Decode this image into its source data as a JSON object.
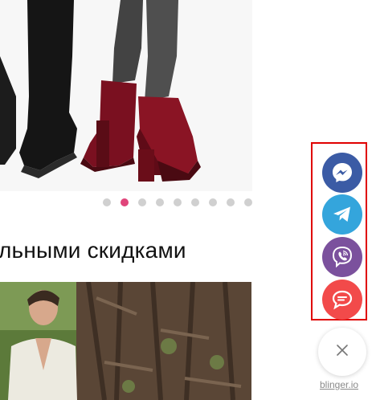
{
  "carousel": {
    "dot_count": 9,
    "active_index": 1,
    "active_color": "#e0457b",
    "dot_color": "#d0d0d0"
  },
  "section": {
    "heading": "льными скидками"
  },
  "widget": {
    "buttons": [
      {
        "name": "messenger",
        "icon": "messenger-icon",
        "color": "#3b5ba5"
      },
      {
        "name": "telegram",
        "icon": "telegram-icon",
        "color": "#34a5dc"
      },
      {
        "name": "viber",
        "icon": "viber-icon",
        "color": "#7b519d"
      },
      {
        "name": "chat",
        "icon": "chat-bubble-icon",
        "color": "#f24a4a"
      }
    ],
    "panel_border_color": "#e00000",
    "close_icon": "close-icon",
    "brand_link": "blinger.io"
  }
}
